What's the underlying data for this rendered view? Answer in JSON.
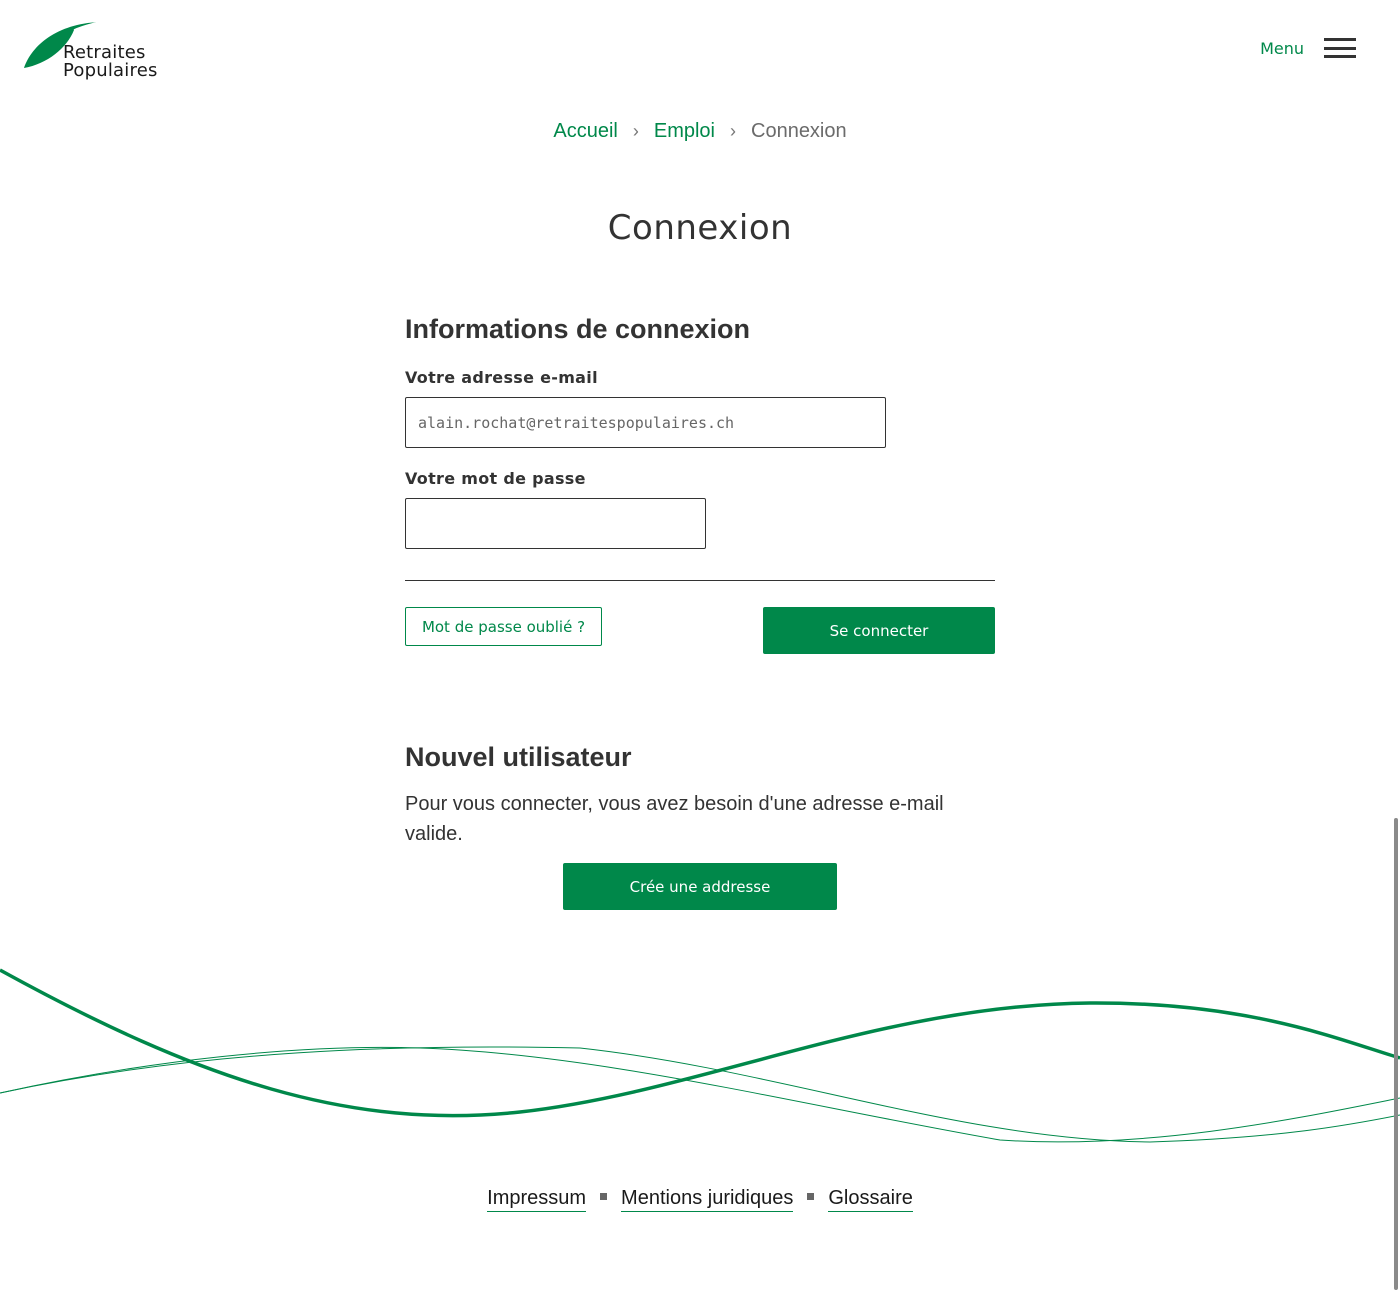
{
  "header": {
    "logo_line1": "Retraites",
    "logo_line2": "Populaires",
    "menu_label": "Menu"
  },
  "breadcrumb": {
    "items": [
      "Accueil",
      "Emploi"
    ],
    "separator": "›",
    "current": "Connexion"
  },
  "page_title": "Connexion",
  "login": {
    "section_title": "Informations de connexion",
    "email_label": "Votre adresse e-mail",
    "email_value": "alain.rochat@retraitespopulaires.ch",
    "password_label": "Votre mot de passe",
    "password_value": "",
    "forgot_label": "Mot de passe oublié ?",
    "submit_label": "Se connecter"
  },
  "new_user": {
    "section_title": "Nouvel utilisateur",
    "description": "Pour vous connecter, vous avez besoin d'une adresse e-mail valide.",
    "create_label": "Crée une addresse"
  },
  "footer": {
    "links": [
      "Impressum",
      "Mentions juridiques",
      "Glossaire"
    ]
  },
  "colors": {
    "brand_green": "#00884a",
    "text_dark": "#333333"
  },
  "icons": {
    "logo": "leaf-icon",
    "menu": "hamburger-icon"
  }
}
